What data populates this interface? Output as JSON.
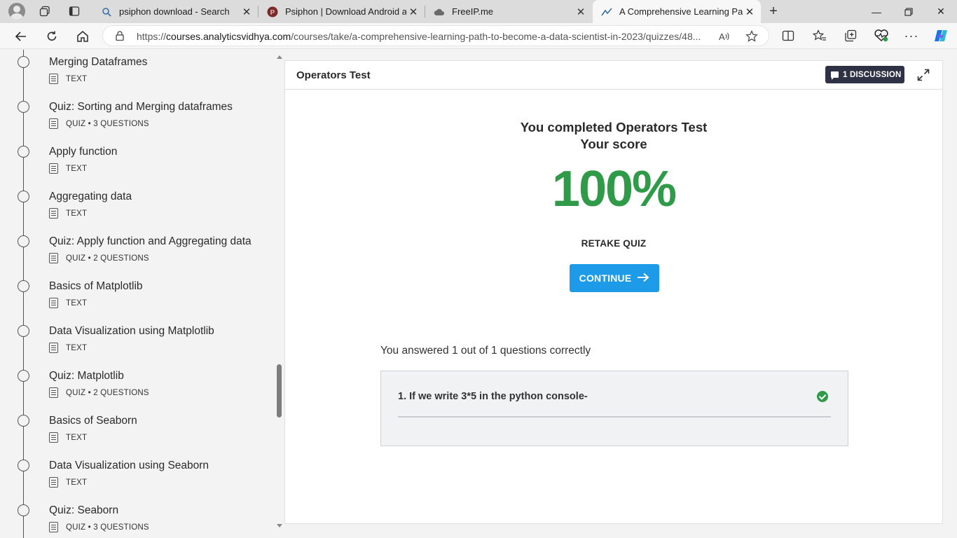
{
  "browser": {
    "tabs": [
      {
        "title": "psiphon download - Search",
        "icon": "search-icon"
      },
      {
        "title": "Psiphon | Download Android app",
        "icon": "psiphon-icon"
      },
      {
        "title": "FreeIP.me",
        "icon": "cloud-icon"
      },
      {
        "title": "A Comprehensive Learning Path t",
        "icon": "analytics-icon",
        "active": true
      }
    ],
    "url_prefix": "https://",
    "url_domain": "courses.analyticsvidhya.com",
    "url_path": "/courses/take/a-comprehensive-learning-path-to-become-a-data-scientist-in-2023/quizzes/48..."
  },
  "sidebar": {
    "items": [
      {
        "title": "Merging Dataframes",
        "meta": "TEXT",
        "kind": "text"
      },
      {
        "title": "Quiz: Sorting and Merging dataframes",
        "meta": "QUIZ • 3 QUESTIONS",
        "kind": "quiz"
      },
      {
        "title": "Apply function",
        "meta": "TEXT",
        "kind": "text"
      },
      {
        "title": "Aggregating data",
        "meta": "TEXT",
        "kind": "text"
      },
      {
        "title": "Quiz: Apply function and Aggregating data",
        "meta": "QUIZ • 2 QUESTIONS",
        "kind": "quiz"
      },
      {
        "title": "Basics of Matplotlib",
        "meta": "TEXT",
        "kind": "text"
      },
      {
        "title": "Data Visualization using Matplotlib",
        "meta": "TEXT",
        "kind": "text"
      },
      {
        "title": "Quiz: Matplotlib",
        "meta": "QUIZ • 2 QUESTIONS",
        "kind": "quiz"
      },
      {
        "title": "Basics of Seaborn",
        "meta": "TEXT",
        "kind": "text"
      },
      {
        "title": "Data Visualization using Seaborn",
        "meta": "TEXT",
        "kind": "text"
      },
      {
        "title": "Quiz: Seaborn",
        "meta": "QUIZ • 3 QUESTIONS",
        "kind": "quiz"
      }
    ]
  },
  "main": {
    "title": "Operators Test",
    "discussion_label": "1 DISCUSSION",
    "completed_text": "You completed Operators Test",
    "score_label": "Your score",
    "score_value": "100%",
    "retake_label": "RETAKE QUIZ",
    "continue_label": "CONTINUE",
    "answered_text": "You answered 1 out of 1 questions correctly",
    "question": "1. If we write 3*5 in the python console-",
    "question_correct": true
  },
  "colors": {
    "accent": "#1e9be8",
    "score_green": "#2f9a48",
    "discussion_bg": "#2e3244"
  }
}
